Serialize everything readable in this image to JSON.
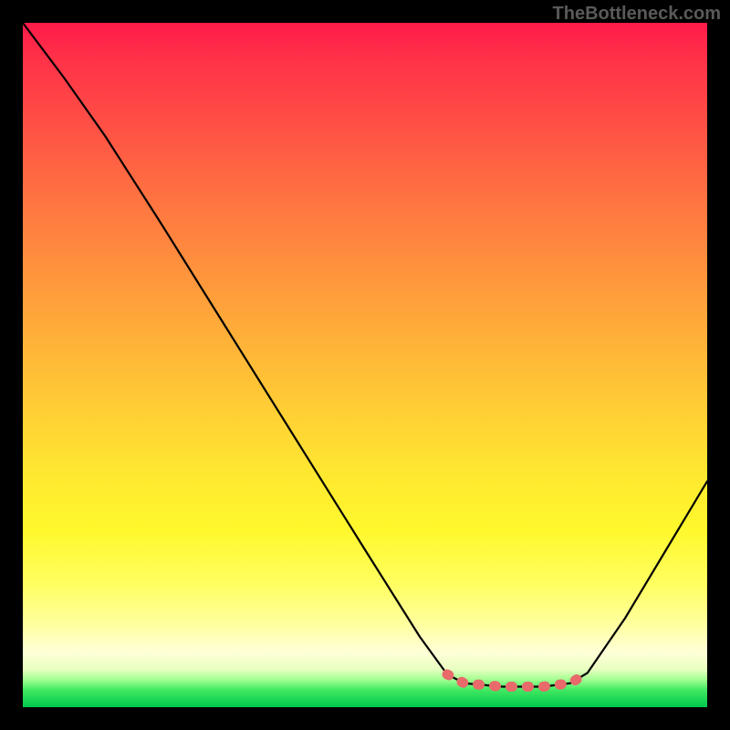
{
  "watermark": "TheBottleneck.com",
  "chart_data": {
    "type": "line",
    "title": "",
    "xlabel": "",
    "ylabel": "",
    "xlim": [
      0,
      100
    ],
    "ylim": [
      0,
      100
    ],
    "series": [
      {
        "name": "curve",
        "points": [
          {
            "x": 0.0,
            "y": 100.0
          },
          {
            "x": 6.0,
            "y": 92.0
          },
          {
            "x": 12.0,
            "y": 83.5
          },
          {
            "x": 20.0,
            "y": 71.0
          },
          {
            "x": 30.0,
            "y": 55.0
          },
          {
            "x": 40.0,
            "y": 39.0
          },
          {
            "x": 50.0,
            "y": 23.0
          },
          {
            "x": 58.0,
            "y": 10.3
          },
          {
            "x": 62.0,
            "y": 4.8
          },
          {
            "x": 64.5,
            "y": 3.5
          },
          {
            "x": 70.0,
            "y": 3.0
          },
          {
            "x": 76.0,
            "y": 3.0
          },
          {
            "x": 80.0,
            "y": 3.5
          },
          {
            "x": 82.5,
            "y": 5.0
          },
          {
            "x": 88.0,
            "y": 13.0
          },
          {
            "x": 94.0,
            "y": 23.0
          },
          {
            "x": 100.0,
            "y": 33.0
          }
        ]
      },
      {
        "name": "highlight",
        "color": "#e86a6a",
        "points": [
          {
            "x": 62.0,
            "y": 4.8
          },
          {
            "x": 64.5,
            "y": 3.5
          },
          {
            "x": 70.0,
            "y": 3.0
          },
          {
            "x": 76.0,
            "y": 3.0
          },
          {
            "x": 80.0,
            "y": 3.5
          },
          {
            "x": 82.5,
            "y": 5.0
          }
        ]
      }
    ],
    "background_gradient": {
      "top": "#ff1a4a",
      "mid": "#ffe000",
      "bottom": "#00c84e"
    }
  }
}
